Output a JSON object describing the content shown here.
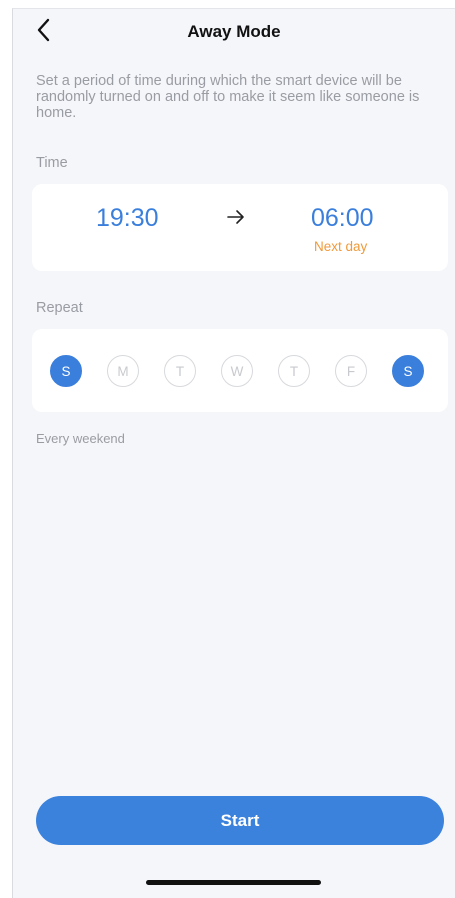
{
  "header": {
    "title": "Away Mode",
    "back_icon": "chevron-left-icon"
  },
  "description": "Set a period of time during which the smart device will be randomly turned on and off to make it seem like someone is home.",
  "time_section": {
    "label": "Time",
    "start": "19:30",
    "arrow_icon": "arrow-right-icon",
    "end": "06:00",
    "end_note": "Next day"
  },
  "repeat_section": {
    "label": "Repeat",
    "days": [
      {
        "letter": "S",
        "selected": true
      },
      {
        "letter": "M",
        "selected": false
      },
      {
        "letter": "T",
        "selected": false
      },
      {
        "letter": "W",
        "selected": false
      },
      {
        "letter": "T",
        "selected": false
      },
      {
        "letter": "F",
        "selected": false
      },
      {
        "letter": "S",
        "selected": true
      }
    ],
    "summary": "Every weekend"
  },
  "start_button": {
    "label": "Start"
  },
  "colors": {
    "accent": "#3b7fdc",
    "next_day": "#f09a3a",
    "background": "#f5f6fa",
    "muted_text": "#9a9ca3"
  }
}
